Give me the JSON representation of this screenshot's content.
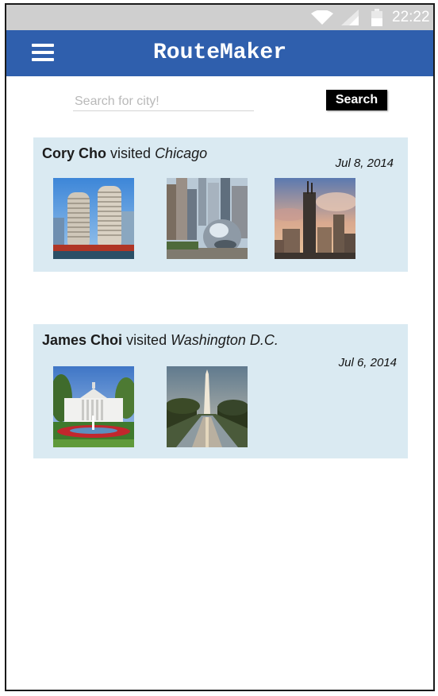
{
  "status_bar": {
    "time": "22:22",
    "icons": [
      "wifi-icon",
      "cell-signal-icon",
      "battery-icon"
    ]
  },
  "app_bar": {
    "title": "RouteMaker",
    "menu_icon": "hamburger-menu-icon",
    "color": "#2f5fad"
  },
  "search": {
    "placeholder": "Search for city!",
    "value": "",
    "button_label": "Search"
  },
  "feed": [
    {
      "user": "Cory Cho",
      "verb": "visited",
      "city": "Chicago",
      "date": "Jul 8, 2014",
      "photos": [
        "marina-city-towers",
        "cloud-gate-bean",
        "willis-tower-skyline"
      ]
    },
    {
      "user": "James Choi",
      "verb": "visited",
      "city": "Washington D.C.",
      "date": "Jul 6, 2014",
      "photos": [
        "white-house",
        "washington-monument"
      ]
    }
  ],
  "colors": {
    "card_background": "#daeaf2",
    "status_bar": "#cfcfcf"
  }
}
